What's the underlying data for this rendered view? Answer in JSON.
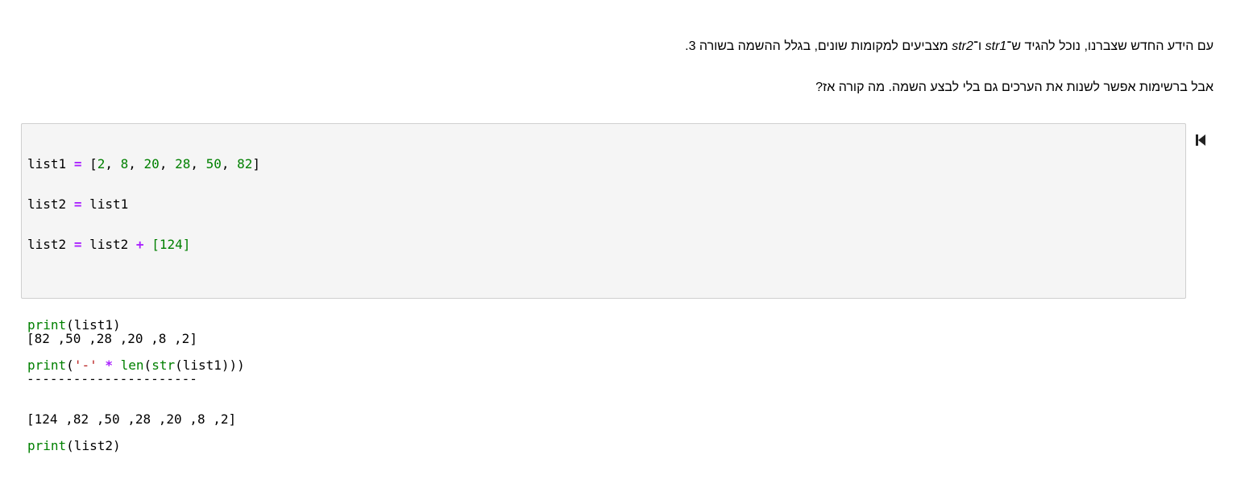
{
  "markdown": {
    "p1_start": "עם הידע החדש שצברנו, נוכל להגיד ש־",
    "p1_var1": "str1",
    "p1_mid": " ו־",
    "p1_var2": "str2",
    "p1_end": " מצביעים למקומות שונים, בגלל ההשמה בשורה 3.",
    "p2": "אבל ברשימות אפשר לשנות את הערכים גם בלי לבצע השמה. מה קורה אז?"
  },
  "code": {
    "l1": {
      "var": "list1",
      "eq": "=",
      "open": "[",
      "n": [
        "2",
        "8",
        "20",
        "28",
        "50",
        "82"
      ],
      "close": "]"
    },
    "l2": {
      "var": "list2",
      "eq": "=",
      "rhs": "list1"
    },
    "l3": {
      "var": "list2",
      "eq": "=",
      "rhs": "list2",
      "plus": "+",
      "lit": "[124]"
    },
    "l5": {
      "fn": "print",
      "arg": "(list1)"
    },
    "l6": {
      "fn": "print",
      "p_open": "(",
      "s": "'-'",
      "star": "*",
      "len": "len",
      "str": "str",
      "rest": "(list1)))"
    },
    "l8": {
      "fn": "print",
      "arg": "(list2)"
    }
  },
  "output": {
    "line1": "[2, 8, 20, 28, 50, 82]",
    "line2": "----------------------",
    "line3": "[2, 8, 20, 28, 50, 82, 124]"
  },
  "run_icon": "skip-to-start-icon"
}
